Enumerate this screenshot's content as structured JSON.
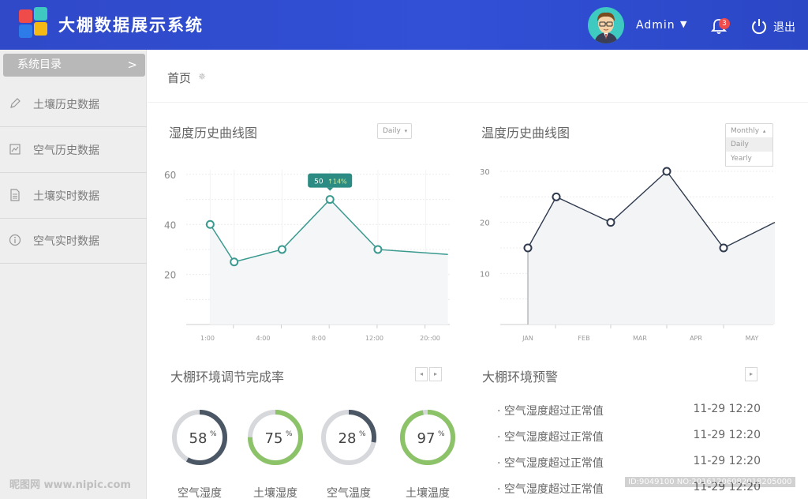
{
  "header": {
    "title": "大棚数据展示系统",
    "user": "Admin",
    "notifications": "3",
    "logout": "退出",
    "logo_colors": [
      "#f04b4b",
      "#3ec9c1",
      "#2d7be8",
      "#f5b916"
    ]
  },
  "sidebar": {
    "heading": "系统目录",
    "items": [
      {
        "label": "土壤历史数据",
        "icon": "pencil-icon"
      },
      {
        "label": "空气历史数据",
        "icon": "chart-icon"
      },
      {
        "label": "土壤实时数据",
        "icon": "document-icon"
      },
      {
        "label": "空气实时数据",
        "icon": "info-icon"
      }
    ]
  },
  "breadcrumb": {
    "label": "首页"
  },
  "humidity_panel": {
    "title": "湿度历史曲线图",
    "select": "Daily"
  },
  "temperature_panel": {
    "title": "温度历史曲线图",
    "select": "Monthly",
    "options": [
      "Daily",
      "Yearly"
    ]
  },
  "completion_panel": {
    "title": "大棚环境调节完成率"
  },
  "alerts_panel": {
    "title": "大棚环境预警",
    "rows": [
      {
        "text": "· 空气湿度超过正常值",
        "time": "11-29 12:20"
      },
      {
        "text": "· 空气湿度超过正常值",
        "time": "11-29 12:20"
      },
      {
        "text": "· 空气湿度超过正常值",
        "time": "11-29 12:20"
      },
      {
        "text": "· 空气湿度超过正常值",
        "time": "11-29 12:20"
      }
    ]
  },
  "chart_data": [
    {
      "type": "line",
      "title": "湿度历史曲线图",
      "x": [
        1,
        2,
        4,
        6,
        8,
        10
      ],
      "tick_labels": [
        "1:00",
        "4:00",
        "8:00",
        "12:00",
        "20::00"
      ],
      "values": [
        40,
        25,
        30,
        50,
        30,
        28
      ],
      "ylim": [
        0,
        60
      ],
      "yticks": [
        20,
        40,
        60
      ],
      "tooltip": {
        "value": "50",
        "change": "↑14%"
      },
      "color": "#3a9a8f"
    },
    {
      "type": "line",
      "title": "温度历史曲线图",
      "categories": [
        "JAN",
        "FEB",
        "MAR",
        "APR",
        "MAY"
      ],
      "values": [
        15,
        25,
        20,
        30,
        15,
        20
      ],
      "ylim": [
        0,
        30
      ],
      "yticks": [
        10,
        20,
        30
      ],
      "color": "#2f3a4e"
    }
  ],
  "gauges": [
    {
      "value": 58,
      "unit": "%",
      "label": "空气湿度",
      "color": "#4c5766"
    },
    {
      "value": 75,
      "unit": "%",
      "label": "土壤湿度",
      "color": "#8cc268"
    },
    {
      "value": 28,
      "unit": "%",
      "label": "空气温度",
      "color": "#4c5766"
    },
    {
      "value": 97,
      "unit": "%",
      "label": "土壤温度",
      "color": "#8cc268"
    }
  ],
  "watermarks": {
    "left": "昵图网 www.nipic.com",
    "right": "ID:9049100 NO:20161206082018205000"
  }
}
